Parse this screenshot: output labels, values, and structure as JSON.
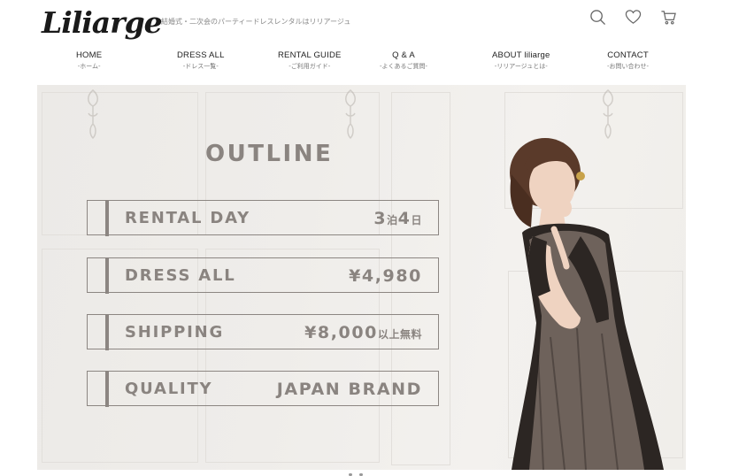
{
  "header": {
    "logo_text": "Liliarge",
    "tagline": "結婚式・二次会のパーティードレスレンタルはリリアージュ",
    "icons": [
      "search-icon",
      "heart-icon",
      "cart-icon"
    ]
  },
  "nav": {
    "items": [
      {
        "en": "HOME",
        "jp": "-ホーム-"
      },
      {
        "en": "DRESS ALL",
        "jp": "-ドレス一覧-"
      },
      {
        "en": "RENTAL GUIDE",
        "jp": "-ご利用ガイド-"
      },
      {
        "en": "Q & A",
        "jp": "-よくあるご質問-"
      },
      {
        "en": "ABOUT liliarge",
        "jp": "-リリアージュとは-"
      },
      {
        "en": "CONTACT",
        "jp": "-お問い合わせ-"
      }
    ]
  },
  "hero": {
    "title": "OUTLINE",
    "rows": [
      {
        "label": "RENTAL DAY",
        "value_main_1": "3",
        "value_sub_1": "泊",
        "value_main_2": "4",
        "value_sub_2": "日"
      },
      {
        "label": "DRESS ALL",
        "value_main": "¥4,980"
      },
      {
        "label": "SHIPPING",
        "value_main": "¥8,000",
        "value_sub": "以上無料"
      },
      {
        "label": "QUALITY",
        "value_main": "JAPAN BRAND"
      }
    ]
  },
  "colors": {
    "accent_text": "#8a8480",
    "logo_accent": "#c59a2d",
    "hero_bg": "#efedea"
  }
}
